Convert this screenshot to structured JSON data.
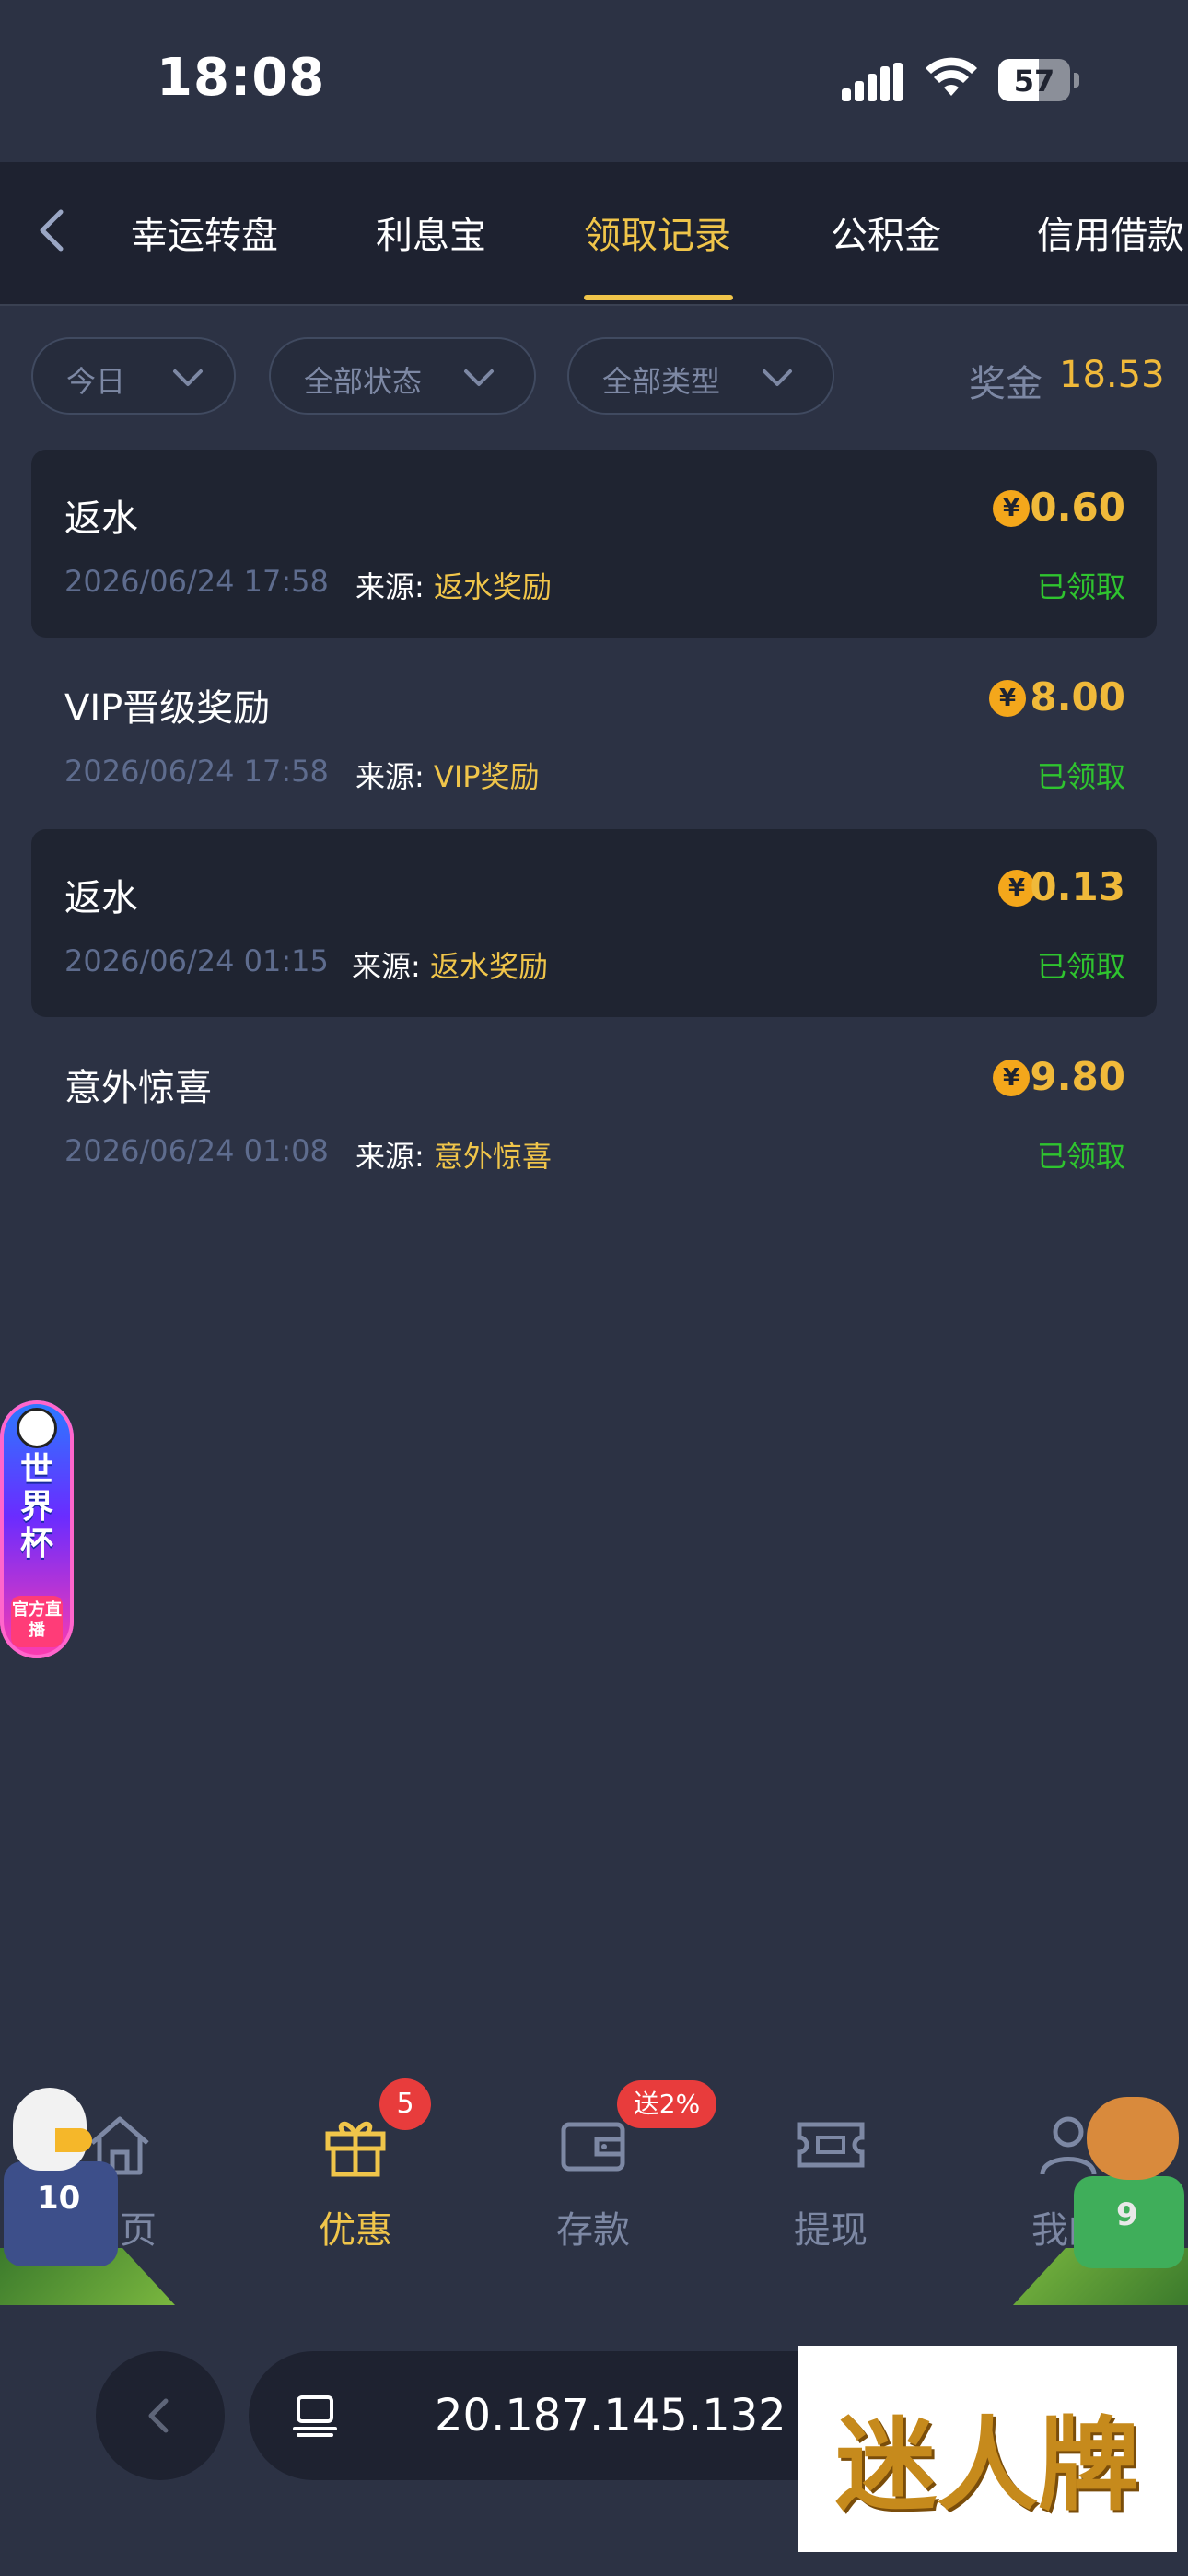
{
  "status_bar": {
    "time": "18:08",
    "battery": "57"
  },
  "tabs": [
    {
      "label": "幸运转盘",
      "active": false
    },
    {
      "label": "利息宝",
      "active": false
    },
    {
      "label": "领取记录",
      "active": true
    },
    {
      "label": "公积金",
      "active": false
    },
    {
      "label": "信用借款",
      "active": false
    }
  ],
  "filters": {
    "date": "今日",
    "status": "全部状态",
    "type": "全部类型",
    "bonus_label": "奖金",
    "bonus_value": "18.53"
  },
  "records": [
    {
      "title": "返水",
      "date": "2026/06/24 17:58",
      "source_label": "来源:",
      "source": "返水奖励",
      "amount": "0.60",
      "status": "已领取",
      "coin": "¥"
    },
    {
      "title": "VIP晋级奖励",
      "date": "2026/06/24 17:58",
      "source_label": "来源:",
      "source": "VIP奖励",
      "amount": "8.00",
      "status": "已领取",
      "coin": "¥"
    },
    {
      "title": "返水",
      "date": "2026/06/24 01:15",
      "source_label": "来源:",
      "source": "返水奖励",
      "amount": "0.13",
      "status": "已领取",
      "coin": "¥"
    },
    {
      "title": "意外惊喜",
      "date": "2026/06/24 01:08",
      "source_label": "来源:",
      "source": "意外惊喜",
      "amount": "9.80",
      "status": "已领取",
      "coin": "¥"
    }
  ],
  "world_cup_badge": {
    "title": "世界杯",
    "subtitle": "官方直播"
  },
  "bottom_nav": [
    {
      "label": "首页",
      "icon": "home-icon"
    },
    {
      "label": "优惠",
      "icon": "gift-icon",
      "badge": "5"
    },
    {
      "label": "存款",
      "icon": "wallet-icon",
      "badge": "送2%"
    },
    {
      "label": "提现",
      "icon": "cash-ticket-icon"
    },
    {
      "label": "我的",
      "icon": "user-icon"
    }
  ],
  "mascots": {
    "left_number": "10",
    "right_number": "9"
  },
  "browser": {
    "url": "20.187.145.132"
  },
  "watermark": {
    "text": "迷人牌"
  },
  "colors": {
    "accent": "#f0c54a",
    "amount": "#f0b93a",
    "success": "#2fc42f",
    "bg": "#2c3244",
    "card": "#1f2431"
  }
}
